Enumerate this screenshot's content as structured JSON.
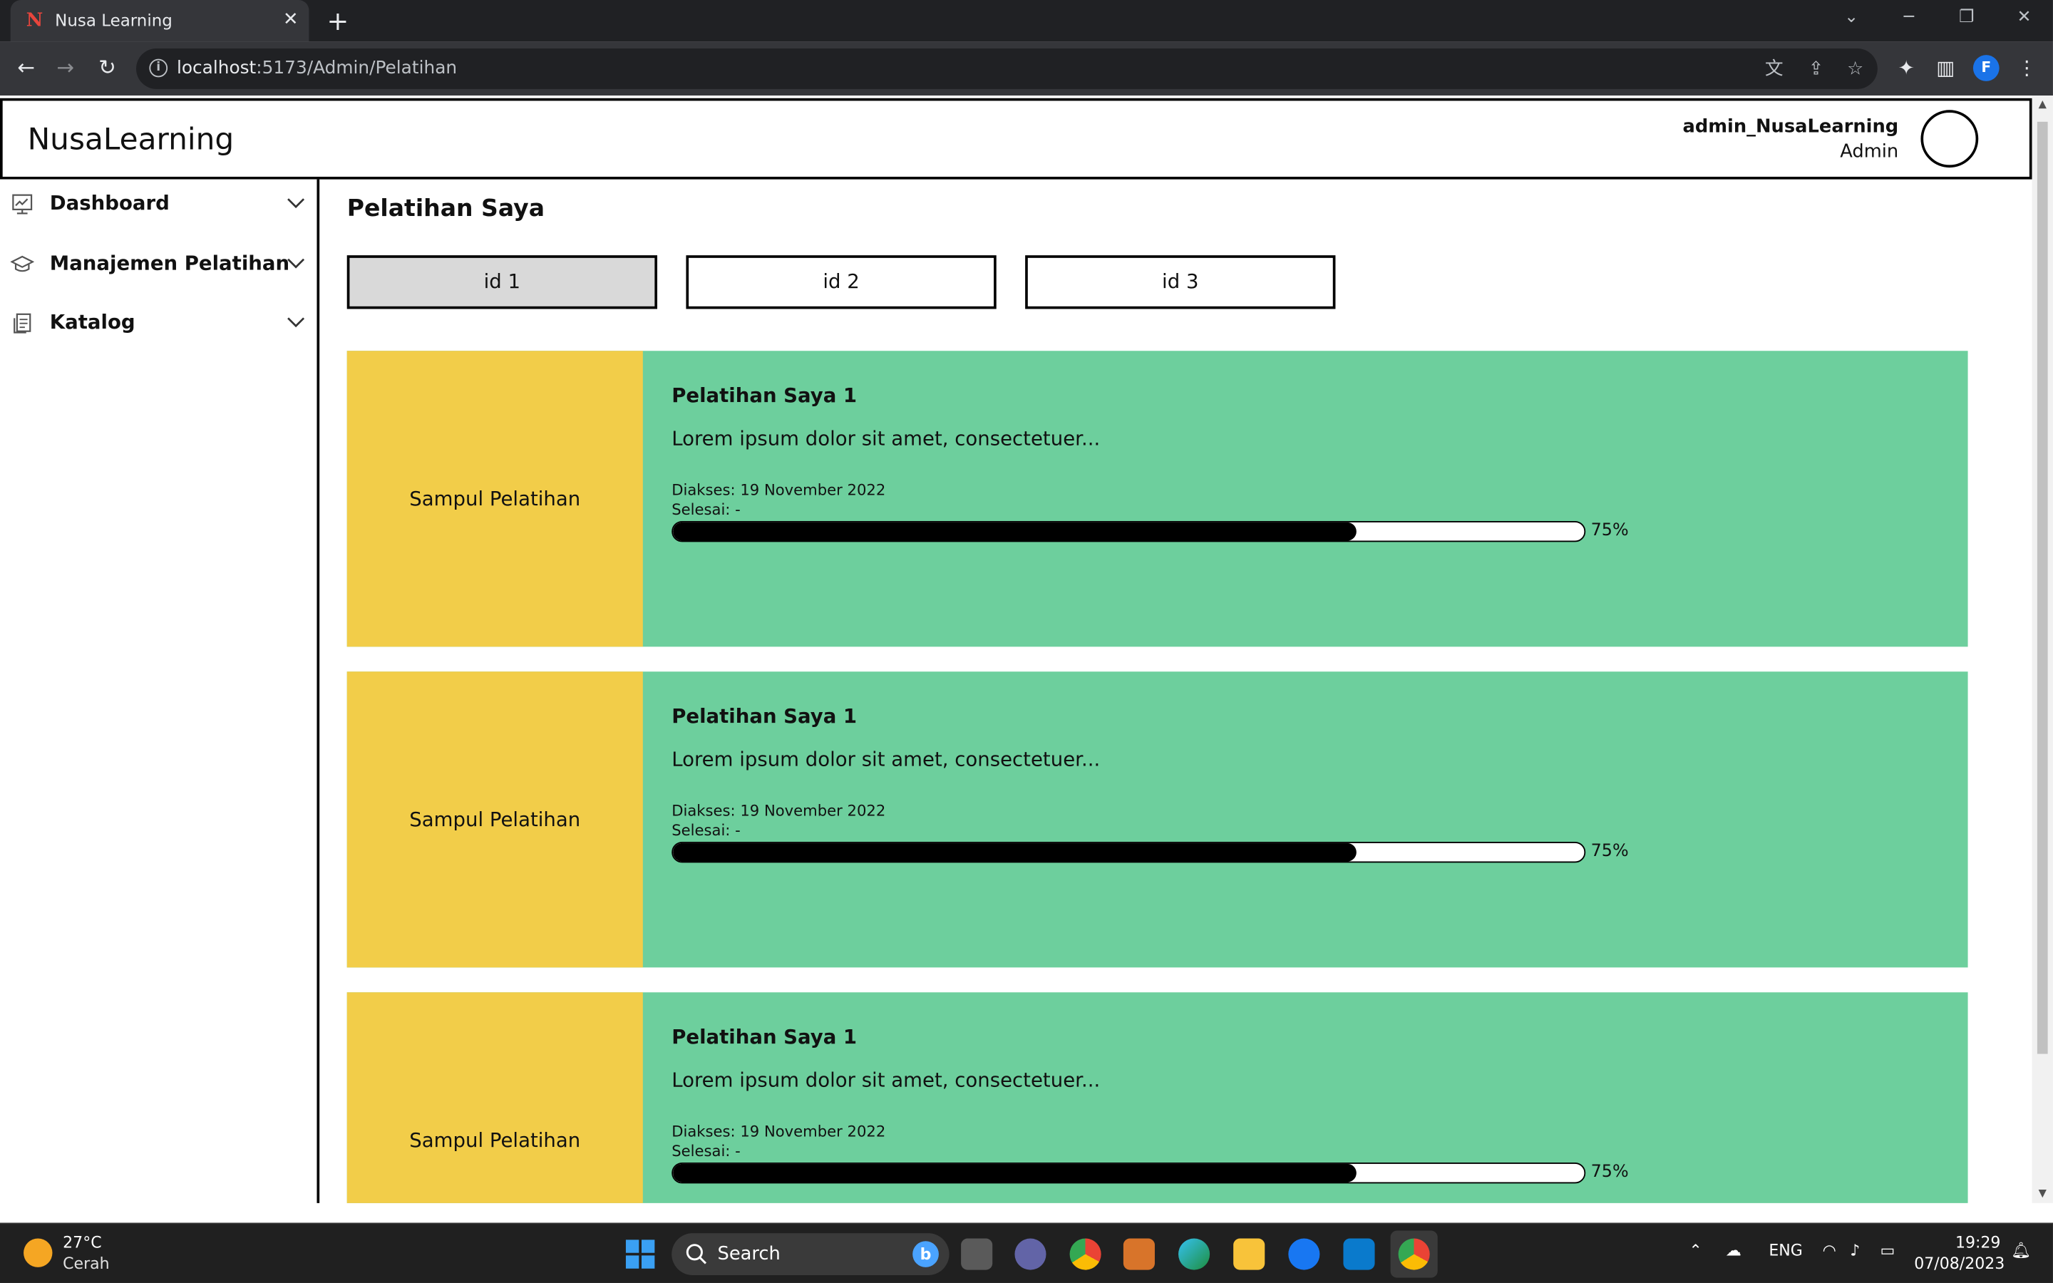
{
  "browser": {
    "tab_title": "Nusa Learning",
    "tab_close": "✕",
    "new_tab": "+",
    "url_host": "localhost",
    "url_path": ":5173/Admin/Pelatihan",
    "profile_initial": "F",
    "icons": [
      "back-icon",
      "forward-icon",
      "reload-icon",
      "info-icon",
      "translate-icon",
      "share-icon",
      "bookmark-star-icon",
      "extensions-icon",
      "side-panel-icon",
      "menu-icon"
    ]
  },
  "header": {
    "brand": "NusaLearning",
    "user_name": "admin_NusaLearning",
    "user_role": "Admin"
  },
  "sidebar": {
    "items": [
      {
        "label": "Dashboard",
        "icon": "chart-board-icon"
      },
      {
        "label": "Manajemen Pelatihan",
        "icon": "graduation-cap-icon"
      },
      {
        "label": "Katalog",
        "icon": "catalog-icon"
      }
    ]
  },
  "main": {
    "title": "Pelatihan Saya",
    "tabs": [
      {
        "label": "id 1",
        "active": true
      },
      {
        "label": "id 2",
        "active": false
      },
      {
        "label": "id 3",
        "active": false
      }
    ],
    "cards": [
      {
        "cover": "Sampul Pelatihan",
        "title": "Pelatihan Saya 1",
        "desc": "Lorem ipsum dolor sit amet, consectetuer...",
        "accessed": "Diakses: 19 November 2022",
        "finished": "Selesai: -",
        "progress": 75,
        "progress_label": "75%"
      },
      {
        "cover": "Sampul Pelatihan",
        "title": "Pelatihan Saya 1",
        "desc": "Lorem ipsum dolor sit amet, consectetuer...",
        "accessed": "Diakses: 19 November 2022",
        "finished": "Selesai: -",
        "progress": 75,
        "progress_label": "75%"
      },
      {
        "cover": "Sampul Pelatihan",
        "title": "Pelatihan Saya 1",
        "desc": "Lorem ipsum dolor sit amet, consectetuer...",
        "accessed": "Diakses: 19 November 2022",
        "finished": "Selesai: -",
        "progress": 75,
        "progress_label": "75%"
      }
    ]
  },
  "colors": {
    "card_bg": "#6dcf9d",
    "cover_bg": "#f2cd49",
    "active_tab_bg": "#d9d9d9"
  },
  "taskbar": {
    "weather_temp": "27°C",
    "weather_desc": "Cerah",
    "search_label": "Search",
    "language": "ENG",
    "time": "19:29",
    "date": "07/08/2023"
  }
}
